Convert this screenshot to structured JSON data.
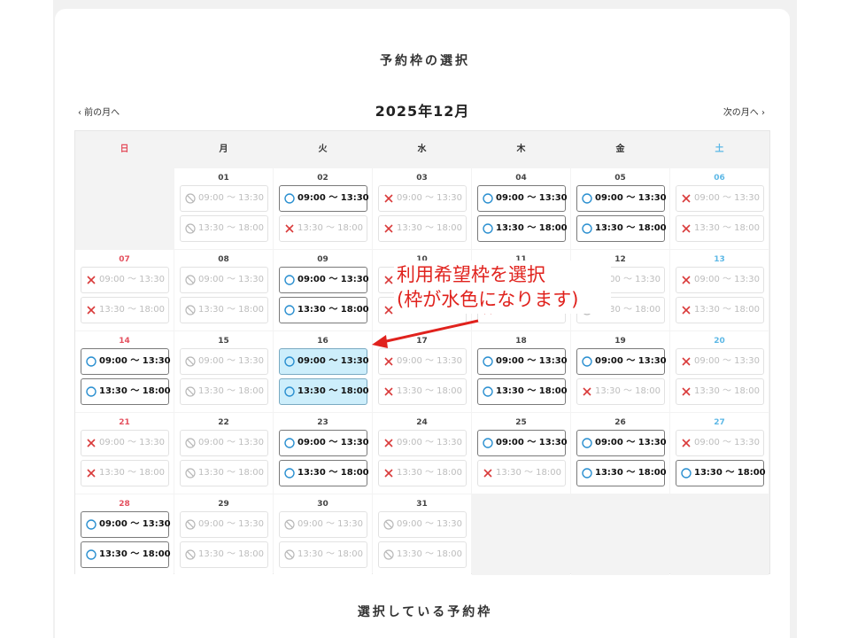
{
  "header": {
    "title": "予約枠の選択"
  },
  "nav": {
    "prev": "‹  前の月へ",
    "next": "次の月へ  ›",
    "month": "2025年12月"
  },
  "weekdays": [
    "日",
    "月",
    "火",
    "水",
    "木",
    "金",
    "土"
  ],
  "colors": {
    "sunday": "#e4505e",
    "saturday": "#5db8e6",
    "avail_circle": "#2a8fd0",
    "full_cross": "#d93a3a",
    "selected_bg": "#cdeefb",
    "annotation": "#e0221d"
  },
  "weeks": [
    [
      null,
      {
        "day": "01",
        "slots": [
          {
            "time": "09:00 ～ 13:30",
            "status": "closed"
          },
          {
            "time": "13:30 ～ 18:00",
            "status": "closed"
          }
        ]
      },
      {
        "day": "02",
        "slots": [
          {
            "time": "09:00 ～ 13:30",
            "status": "avail"
          },
          {
            "time": "13:30 ～ 18:00",
            "status": "full"
          }
        ]
      },
      {
        "day": "03",
        "slots": [
          {
            "time": "09:00 ～ 13:30",
            "status": "full"
          },
          {
            "time": "13:30 ～ 18:00",
            "status": "full"
          }
        ]
      },
      {
        "day": "04",
        "slots": [
          {
            "time": "09:00 ～ 13:30",
            "status": "avail"
          },
          {
            "time": "13:30 ～ 18:00",
            "status": "avail"
          }
        ]
      },
      {
        "day": "05",
        "slots": [
          {
            "time": "09:00 ～ 13:30",
            "status": "avail"
          },
          {
            "time": "13:30 ～ 18:00",
            "status": "avail"
          }
        ]
      },
      {
        "day": "06",
        "slots": [
          {
            "time": "09:00 ～ 13:30",
            "status": "full"
          },
          {
            "time": "13:30 ～ 18:00",
            "status": "full"
          }
        ]
      }
    ],
    [
      {
        "day": "07",
        "slots": [
          {
            "time": "09:00 ～ 13:30",
            "status": "full"
          },
          {
            "time": "13:30 ～ 18:00",
            "status": "full"
          }
        ]
      },
      {
        "day": "08",
        "slots": [
          {
            "time": "09:00 ～ 13:30",
            "status": "closed"
          },
          {
            "time": "13:30 ～ 18:00",
            "status": "closed"
          }
        ]
      },
      {
        "day": "09",
        "slots": [
          {
            "time": "09:00 ～ 13:30",
            "status": "avail"
          },
          {
            "time": "13:30 ～ 18:00",
            "status": "avail"
          }
        ]
      },
      {
        "day": "10",
        "slots": [
          {
            "time": "09:00 ～ 13:30",
            "status": "full"
          },
          {
            "time": "13:30 ～ 18:00",
            "status": "full"
          }
        ]
      },
      {
        "day": "11",
        "slots": [
          {
            "time": "09:00 ～ 13:30",
            "status": "full"
          },
          {
            "time": "13:30 ～ 18:00",
            "status": "full"
          }
        ]
      },
      {
        "day": "12",
        "slots": [
          {
            "time": "09:00 ～ 13:30",
            "status": "closed"
          },
          {
            "time": "13:30 ～ 18:00",
            "status": "closed"
          }
        ]
      },
      {
        "day": "13",
        "slots": [
          {
            "time": "09:00 ～ 13:30",
            "status": "full"
          },
          {
            "time": "13:30 ～ 18:00",
            "status": "full"
          }
        ]
      }
    ],
    [
      {
        "day": "14",
        "slots": [
          {
            "time": "09:00 ～ 13:30",
            "status": "avail"
          },
          {
            "time": "13:30 ～ 18:00",
            "status": "avail"
          }
        ]
      },
      {
        "day": "15",
        "slots": [
          {
            "time": "09:00 ～ 13:30",
            "status": "closed"
          },
          {
            "time": "13:30 ～ 18:00",
            "status": "closed"
          }
        ]
      },
      {
        "day": "16",
        "slots": [
          {
            "time": "09:00 ～ 13:30",
            "status": "selected"
          },
          {
            "time": "13:30 ～ 18:00",
            "status": "selected"
          }
        ]
      },
      {
        "day": "17",
        "slots": [
          {
            "time": "09:00 ～ 13:30",
            "status": "full"
          },
          {
            "time": "13:30 ～ 18:00",
            "status": "full"
          }
        ]
      },
      {
        "day": "18",
        "slots": [
          {
            "time": "09:00 ～ 13:30",
            "status": "avail"
          },
          {
            "time": "13:30 ～ 18:00",
            "status": "avail"
          }
        ]
      },
      {
        "day": "19",
        "slots": [
          {
            "time": "09:00 ～ 13:30",
            "status": "avail"
          },
          {
            "time": "13:30 ～ 18:00",
            "status": "full"
          }
        ]
      },
      {
        "day": "20",
        "slots": [
          {
            "time": "09:00 ～ 13:30",
            "status": "full"
          },
          {
            "time": "13:30 ～ 18:00",
            "status": "full"
          }
        ]
      }
    ],
    [
      {
        "day": "21",
        "slots": [
          {
            "time": "09:00 ～ 13:30",
            "status": "full"
          },
          {
            "time": "13:30 ～ 18:00",
            "status": "full"
          }
        ]
      },
      {
        "day": "22",
        "slots": [
          {
            "time": "09:00 ～ 13:30",
            "status": "closed"
          },
          {
            "time": "13:30 ～ 18:00",
            "status": "closed"
          }
        ]
      },
      {
        "day": "23",
        "slots": [
          {
            "time": "09:00 ～ 13:30",
            "status": "avail"
          },
          {
            "time": "13:30 ～ 18:00",
            "status": "avail"
          }
        ]
      },
      {
        "day": "24",
        "slots": [
          {
            "time": "09:00 ～ 13:30",
            "status": "full"
          },
          {
            "time": "13:30 ～ 18:00",
            "status": "full"
          }
        ]
      },
      {
        "day": "25",
        "slots": [
          {
            "time": "09:00 ～ 13:30",
            "status": "avail"
          },
          {
            "time": "13:30 ～ 18:00",
            "status": "full"
          }
        ]
      },
      {
        "day": "26",
        "slots": [
          {
            "time": "09:00 ～ 13:30",
            "status": "avail"
          },
          {
            "time": "13:30 ～ 18:00",
            "status": "avail"
          }
        ]
      },
      {
        "day": "27",
        "slots": [
          {
            "time": "09:00 ～ 13:30",
            "status": "full"
          },
          {
            "time": "13:30 ～ 18:00",
            "status": "avail"
          }
        ]
      }
    ],
    [
      {
        "day": "28",
        "slots": [
          {
            "time": "09:00 ～ 13:30",
            "status": "avail"
          },
          {
            "time": "13:30 ～ 18:00",
            "status": "avail"
          }
        ]
      },
      {
        "day": "29",
        "slots": [
          {
            "time": "09:00 ～ 13:30",
            "status": "closed"
          },
          {
            "time": "13:30 ～ 18:00",
            "status": "closed"
          }
        ]
      },
      {
        "day": "30",
        "slots": [
          {
            "time": "09:00 ～ 13:30",
            "status": "closed"
          },
          {
            "time": "13:30 ～ 18:00",
            "status": "closed"
          }
        ]
      },
      {
        "day": "31",
        "slots": [
          {
            "time": "09:00 ～ 13:30",
            "status": "closed"
          },
          {
            "time": "13:30 ～ 18:00",
            "status": "closed"
          }
        ]
      },
      null,
      null,
      null
    ]
  ],
  "annotation": {
    "line1": "利用希望枠を選択",
    "line2": "(枠が水色になります)"
  },
  "selected_section": {
    "title": "選択している予約枠"
  }
}
